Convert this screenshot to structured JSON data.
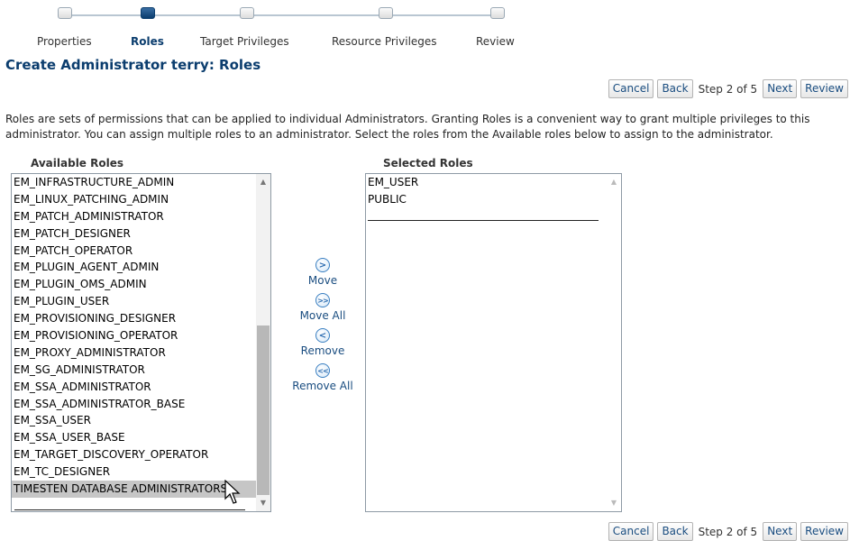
{
  "train": {
    "steps": [
      {
        "label": "Properties",
        "active": false
      },
      {
        "label": "Roles",
        "active": true
      },
      {
        "label": "Target Privileges",
        "active": false
      },
      {
        "label": "Resource Privileges",
        "active": false
      },
      {
        "label": "Review",
        "active": false
      }
    ]
  },
  "page_title": "Create Administrator terry: Roles",
  "toolbar": {
    "cancel_label": "Cancel",
    "back_label": "Back",
    "step_text": "Step 2 of 5",
    "next_label": "Next",
    "review_label": "Review"
  },
  "intro_text": "Roles are sets of permissions that can be applied to individual Administrators. Granting Roles is a convenient way to grant multiple privileges to this administrator. You can assign multiple roles to an administrator. Select the roles from the Available roles below to assign to the administrator.",
  "available": {
    "heading": "Available Roles",
    "items": [
      "EM_INFRASTRUCTURE_ADMIN",
      "EM_LINUX_PATCHING_ADMIN",
      "EM_PATCH_ADMINISTRATOR",
      "EM_PATCH_DESIGNER",
      "EM_PATCH_OPERATOR",
      "EM_PLUGIN_AGENT_ADMIN",
      "EM_PLUGIN_OMS_ADMIN",
      "EM_PLUGIN_USER",
      "EM_PROVISIONING_DESIGNER",
      "EM_PROVISIONING_OPERATOR",
      "EM_PROXY_ADMINISTRATOR",
      "EM_SG_ADMINISTRATOR",
      "EM_SSA_ADMINISTRATOR",
      "EM_SSA_ADMINISTRATOR_BASE",
      "EM_SSA_USER",
      "EM_SSA_USER_BASE",
      "EM_TARGET_DISCOVERY_OPERATOR",
      "EM_TC_DESIGNER",
      "TIMESTEN DATABASE ADMINISTRATORS"
    ],
    "selected_item": "TIMESTEN DATABASE ADMINISTRATORS"
  },
  "selected": {
    "heading": "Selected Roles",
    "items": [
      "EM_USER",
      "PUBLIC"
    ]
  },
  "shuttle": {
    "move": {
      "label": "Move",
      "icon": "chevron-right-icon"
    },
    "move_all": {
      "label": "Move All",
      "icon": "double-chevron-right-icon"
    },
    "remove": {
      "label": "Remove",
      "icon": "chevron-left-icon"
    },
    "remove_all": {
      "label": "Remove All",
      "icon": "double-chevron-left-icon"
    }
  },
  "colors": {
    "accent": "#0b3d6e",
    "link": "#1a4d80",
    "selection": "#c6c6c6"
  }
}
